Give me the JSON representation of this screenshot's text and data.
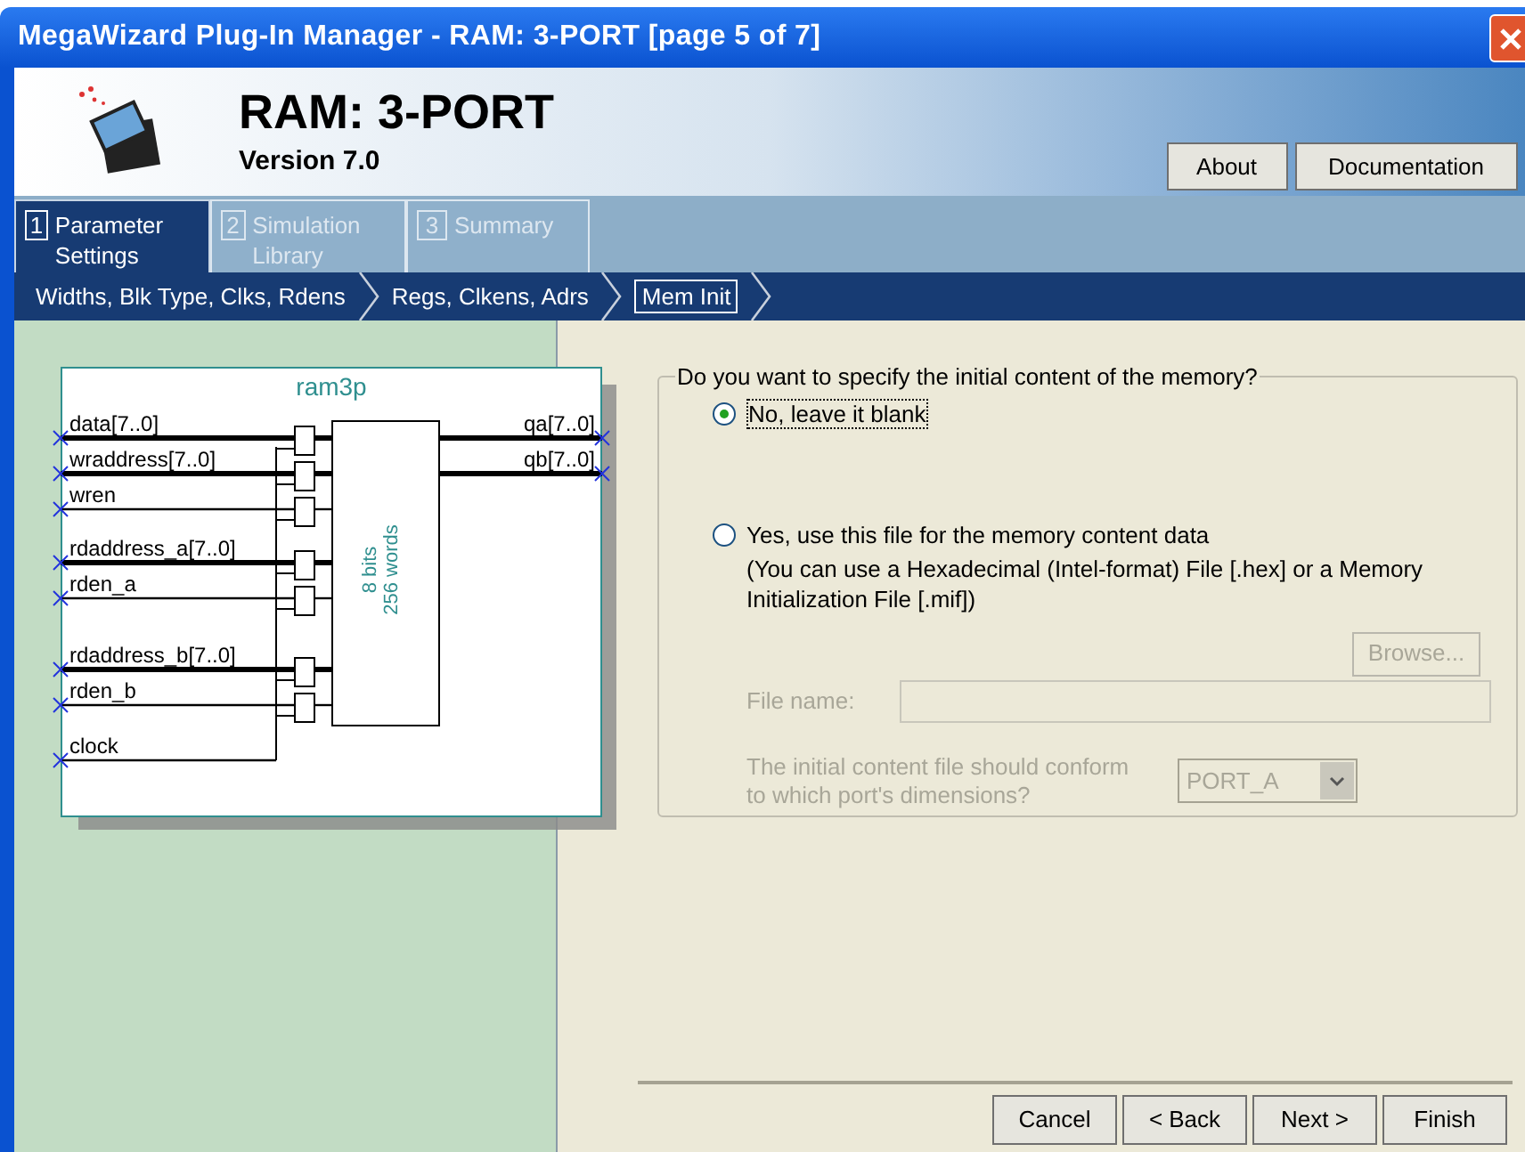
{
  "window": {
    "title": "MegaWizard Plug-In Manager - RAM: 3-PORT [page 5 of 7]"
  },
  "header": {
    "title": "RAM: 3-PORT",
    "version": "Version 7.0",
    "buttons": [
      "About",
      "Documentation"
    ]
  },
  "tabs": [
    {
      "number": "1",
      "label": "Parameter Settings",
      "selected": true
    },
    {
      "number": "2",
      "label": "Simulation Library",
      "selected": false
    },
    {
      "number": "3",
      "label": "Summary",
      "selected": false
    }
  ],
  "breadcrumb": [
    {
      "label": "Widths, Blk Type, Clks, Rdens",
      "selected": false
    },
    {
      "label": "Regs, Clkens, Adrs",
      "selected": false
    },
    {
      "label": "Mem Init",
      "selected": true
    }
  ],
  "symbol": {
    "name": "ram3p",
    "memory": [
      "8 bits",
      "256 words"
    ],
    "inputs": [
      {
        "label": "data[7..0]",
        "kind": "bus"
      },
      {
        "label": "wraddress[7..0]",
        "kind": "bus"
      },
      {
        "label": "wren",
        "kind": "signal"
      },
      {
        "label": "rdaddress_a[7..0]",
        "kind": "bus"
      },
      {
        "label": "rden_a",
        "kind": "signal"
      },
      {
        "label": "rdaddress_b[7..0]",
        "kind": "bus"
      },
      {
        "label": "rden_b",
        "kind": "signal"
      },
      {
        "label": "clock",
        "kind": "clock"
      }
    ],
    "outputs": [
      {
        "label": "qa[7..0]",
        "kind": "bus"
      },
      {
        "label": "qb[7..0]",
        "kind": "bus"
      }
    ]
  },
  "memory_init": {
    "legend": "Do you want to specify the initial content of the memory?",
    "options": [
      {
        "label": "No, leave it blank",
        "selected": true
      },
      {
        "label": "Yes, use this file for the memory content data",
        "selected": false
      }
    ],
    "note": "(You can use a Hexadecimal (Intel-format) File [.hex] or a Memory Initialization File [.mif])",
    "browse": {
      "label": "Browse...",
      "disabled": true
    },
    "file_name": {
      "label": "File name:",
      "disabled": true
    },
    "conform": {
      "label": "The initial content file should conform to which port's dimensions?",
      "value": "PORT_A",
      "disabled": true
    }
  },
  "footer_buttons": [
    "Cancel",
    "< Back",
    "Next >",
    "Finish"
  ]
}
